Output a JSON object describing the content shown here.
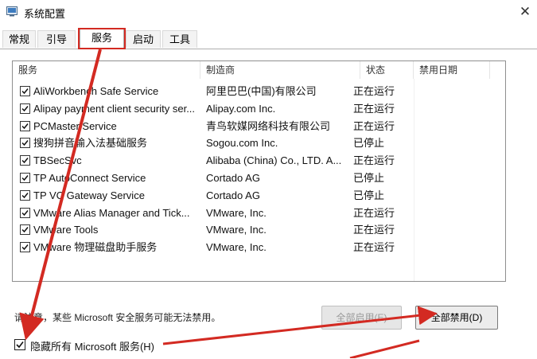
{
  "window": {
    "title": "系统配置",
    "close_glyph": "✕"
  },
  "tabs": [
    {
      "label": "常规"
    },
    {
      "label": "引导"
    },
    {
      "label": "服务",
      "active": true
    },
    {
      "label": "启动"
    },
    {
      "label": "工具"
    }
  ],
  "columns": [
    "服务",
    "制造商",
    "状态",
    "禁用日期"
  ],
  "services": [
    {
      "name": "AliWorkbench Safe Service",
      "maker": "阿里巴巴(中国)有限公司",
      "status": "正在运行",
      "checked": true
    },
    {
      "name": "Alipay payment client security ser...",
      "maker": "Alipay.com Inc.",
      "status": "正在运行",
      "checked": true
    },
    {
      "name": "PCMaster Service",
      "maker": "青鸟软媒网络科技有限公司",
      "status": "正在运行",
      "checked": true
    },
    {
      "name": "搜狗拼音输入法基础服务",
      "maker": "Sogou.com Inc.",
      "status": "已停止",
      "checked": true
    },
    {
      "name": "TBSecSvc",
      "maker": "Alibaba (China) Co., LTD. A...",
      "status": "正在运行",
      "checked": true
    },
    {
      "name": "TP AutoConnect Service",
      "maker": "Cortado AG",
      "status": "已停止",
      "checked": true
    },
    {
      "name": "TP VC Gateway Service",
      "maker": "Cortado AG",
      "status": "已停止",
      "checked": true
    },
    {
      "name": "VMware Alias Manager and Tick...",
      "maker": "VMware, Inc.",
      "status": "正在运行",
      "checked": true
    },
    {
      "name": "VMware Tools",
      "maker": "VMware, Inc.",
      "status": "正在运行",
      "checked": true
    },
    {
      "name": "VMware 物理磁盘助手服务",
      "maker": "VMware, Inc.",
      "status": "正在运行",
      "checked": true
    }
  ],
  "note": "请注意，某些 Microsoft 安全服务可能无法禁用。",
  "buttons": {
    "enable_all": "全部启用(E)",
    "disable_all": "全部禁用(D)"
  },
  "hide_ms": {
    "label": "隐藏所有 Microsoft 服务(H)",
    "checked": true
  },
  "colors": {
    "annotation_red": "#d32a22",
    "tab_highlight": "#d32a22"
  }
}
